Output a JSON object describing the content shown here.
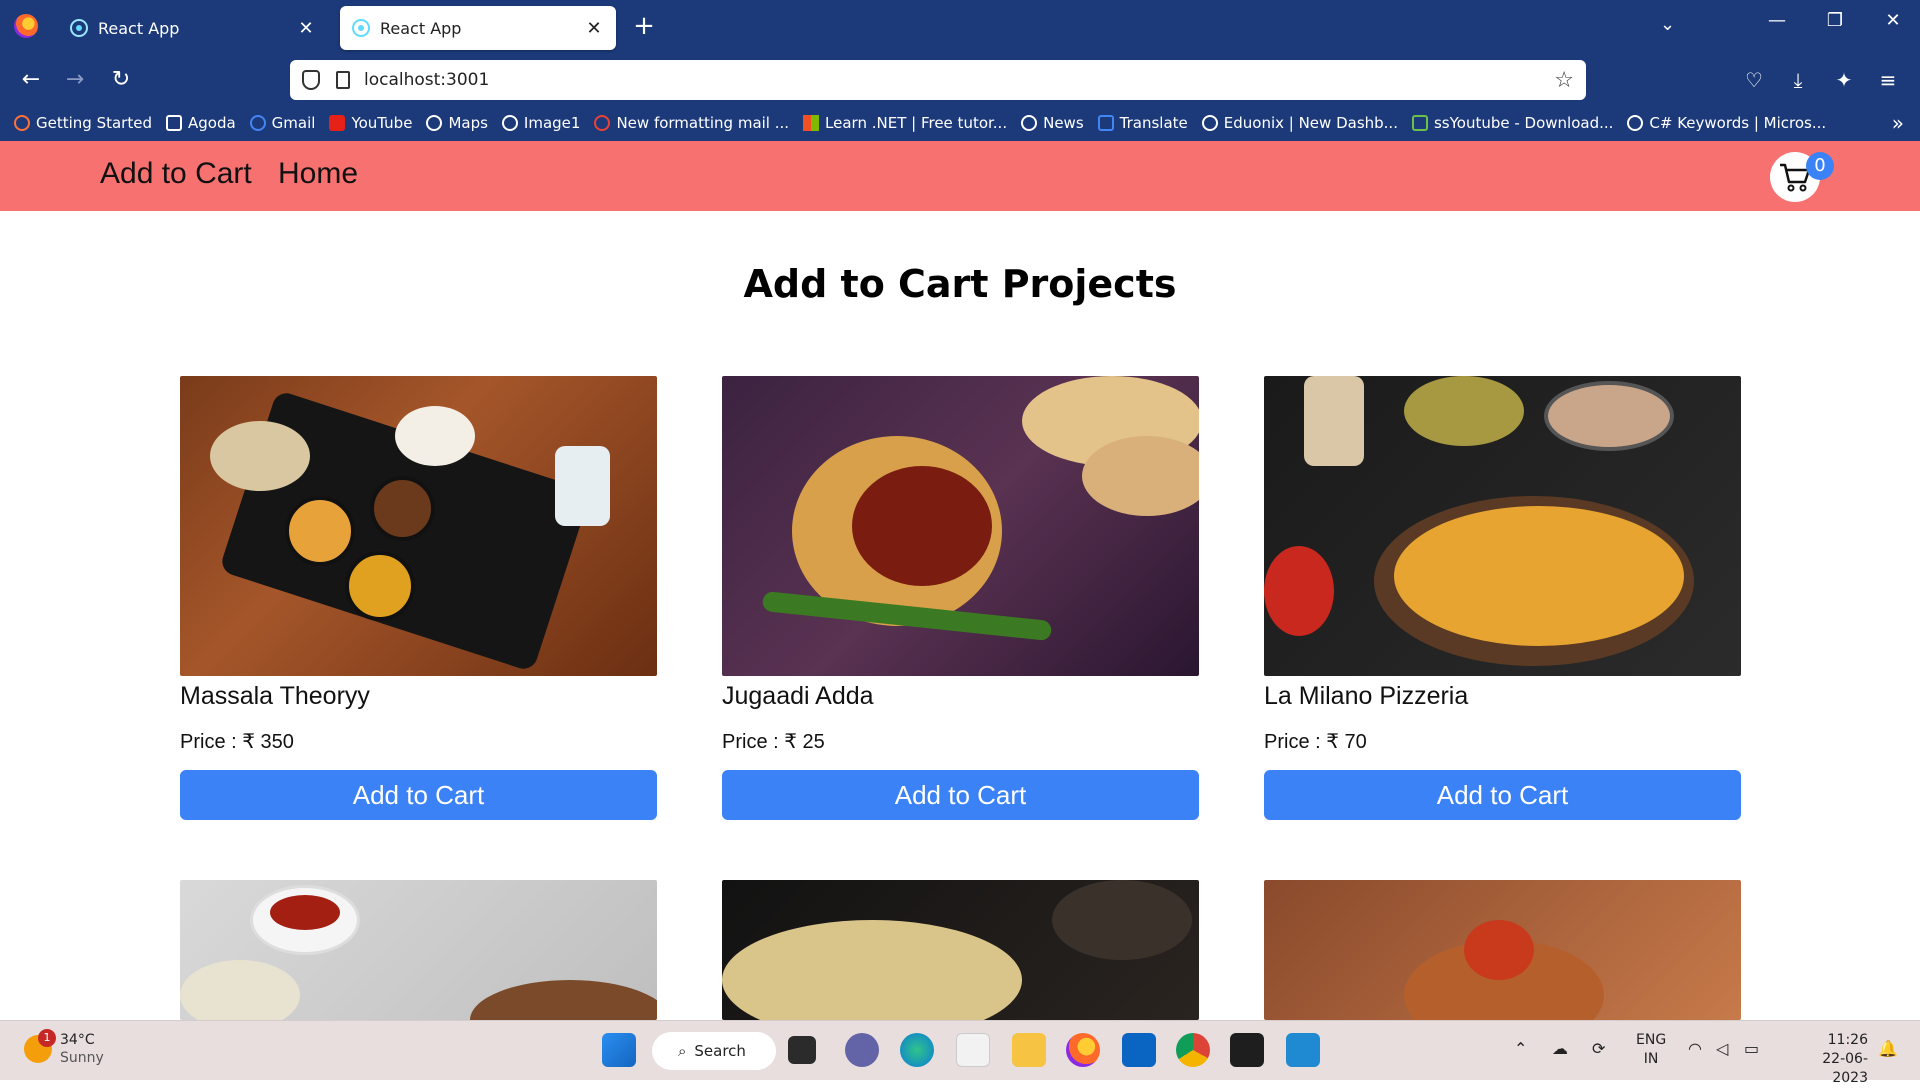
{
  "browser": {
    "tabs": [
      {
        "label": "React App",
        "active": false
      },
      {
        "label": "React App",
        "active": true
      }
    ],
    "new_tab": "+",
    "url": "localhost:3001",
    "bookmarks": [
      "Getting Started",
      "Agoda",
      "Gmail",
      "YouTube",
      "Maps",
      "Image1",
      "New formatting mail ...",
      "Learn .NET | Free tutor...",
      "News",
      "Translate",
      "Eduonix | New Dashb...",
      "ssYoutube - Download...",
      "C# Keywords | Micros..."
    ]
  },
  "app": {
    "nav": {
      "brand": "Add to Cart",
      "home": "Home"
    },
    "cart_count": "0",
    "title": "Add to Cart Projects",
    "products": [
      {
        "name": "Massala Theoryy",
        "price": "Price : ₹ 350",
        "button": "Add to Cart"
      },
      {
        "name": "Jugaadi Adda",
        "price": "Price : ₹ 25",
        "button": "Add to Cart"
      },
      {
        "name": "La Milano Pizzeria",
        "price": "Price : ₹ 70",
        "button": "Add to Cart"
      }
    ]
  },
  "taskbar": {
    "weather_badge": "1",
    "temp": "34°C",
    "condition": "Sunny",
    "search": "Search",
    "lang1": "ENG",
    "lang2": "IN",
    "time": "11:26",
    "date": "22-06-2023"
  },
  "colors": {
    "chrome": "#1c3a7a",
    "header": "#f87171",
    "button": "#3b82f6"
  }
}
